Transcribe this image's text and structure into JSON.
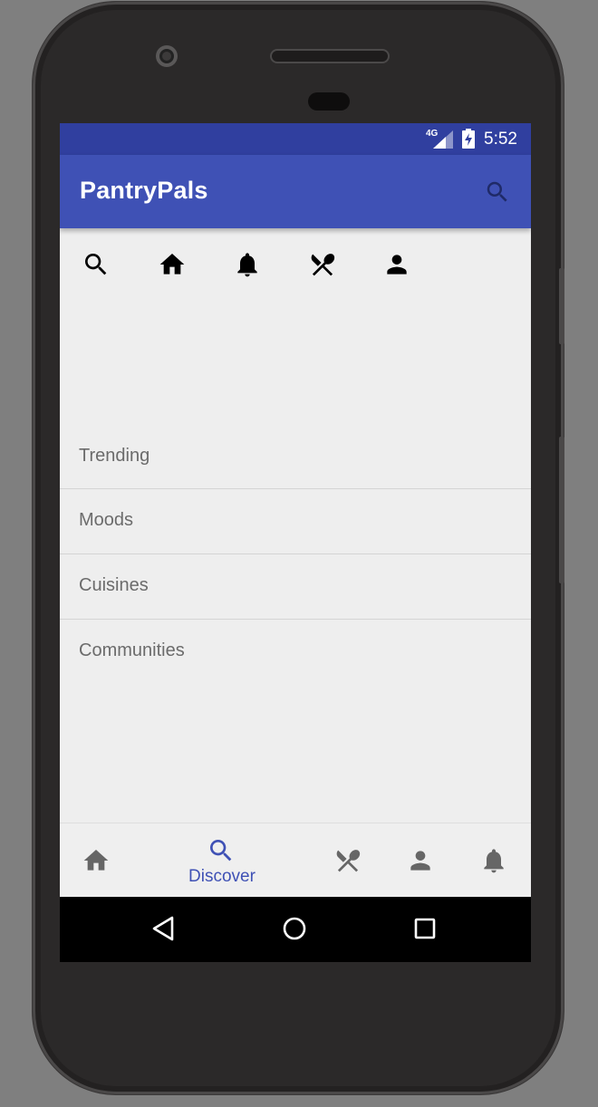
{
  "status_bar": {
    "network": "4G",
    "time": "5:52"
  },
  "app_bar": {
    "title": "PantryPals",
    "action_icon": "search-icon"
  },
  "icon_row": [
    {
      "icon": "search-icon"
    },
    {
      "icon": "home-icon"
    },
    {
      "icon": "bell-icon"
    },
    {
      "icon": "utensils-icon"
    },
    {
      "icon": "person-icon"
    }
  ],
  "categories": [
    "Trending",
    "Moods",
    "Cuisines",
    "Communities"
  ],
  "bottom_nav": {
    "active_label": "Discover",
    "items": [
      {
        "icon": "home-icon"
      },
      {
        "icon": "search-icon",
        "label": "Discover",
        "active": true
      },
      {
        "icon": "utensils-icon"
      },
      {
        "icon": "person-icon"
      },
      {
        "icon": "bell-icon"
      }
    ]
  },
  "system_nav": [
    "back",
    "home",
    "recents"
  ],
  "colors": {
    "primary": "#3f51b5",
    "primary_dark": "#303f9f",
    "background": "#eeeeee",
    "text_secondary": "#6b6b6b",
    "nav_inactive": "#666666"
  }
}
